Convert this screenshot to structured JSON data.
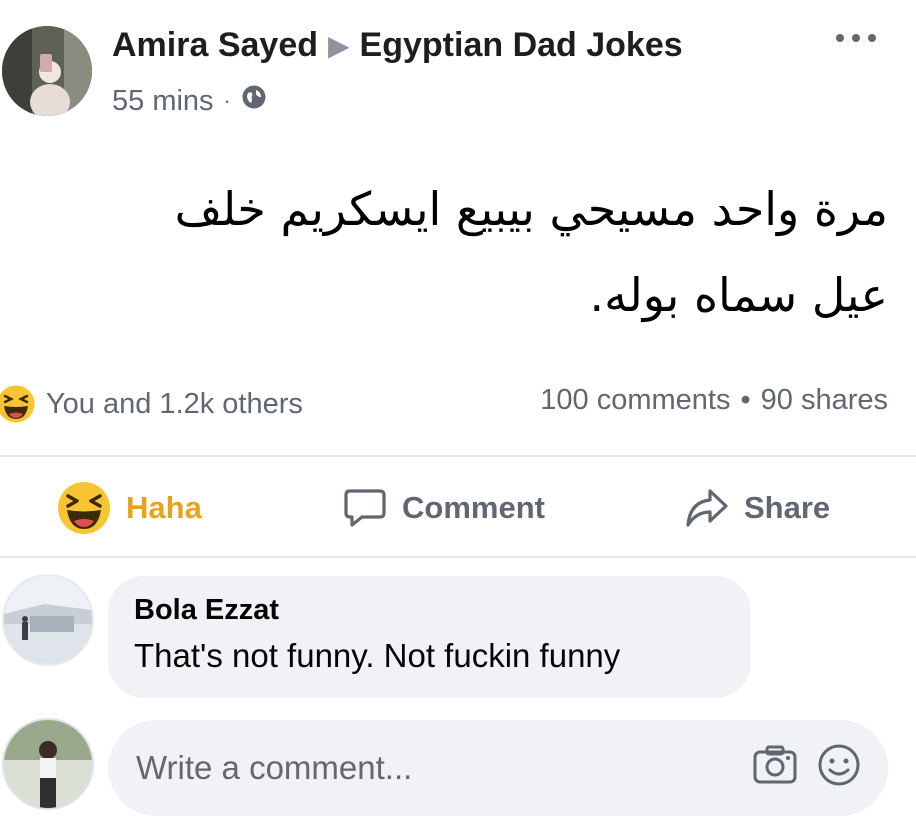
{
  "post": {
    "author": "Amira Sayed",
    "group": "Egyptian Dad Jokes",
    "time": "55 mins",
    "separator": "·",
    "body_lines": [
      "مرة واحد مسيحي بيبيع ايسكريم خلف",
      "عيل سماه بوله."
    ]
  },
  "stats": {
    "reactions_text": "You and 1.2k others",
    "comments": "100 comments",
    "dot": "•",
    "shares": "90 shares"
  },
  "actions": {
    "haha": "Haha",
    "comment": "Comment",
    "share": "Share"
  },
  "comment": {
    "author": "Bola Ezzat",
    "text": "That's not funny. Not fuckin funny"
  },
  "composer": {
    "placeholder": "Write a comment..."
  },
  "colors": {
    "haha_accent": "#e5a41b",
    "muted": "#606770",
    "bubble": "#f0f2f5"
  },
  "icons": [
    "globe-icon",
    "haha-emoji-icon",
    "comment-icon",
    "share-icon",
    "camera-icon",
    "smile-icon",
    "more-options-icon"
  ]
}
